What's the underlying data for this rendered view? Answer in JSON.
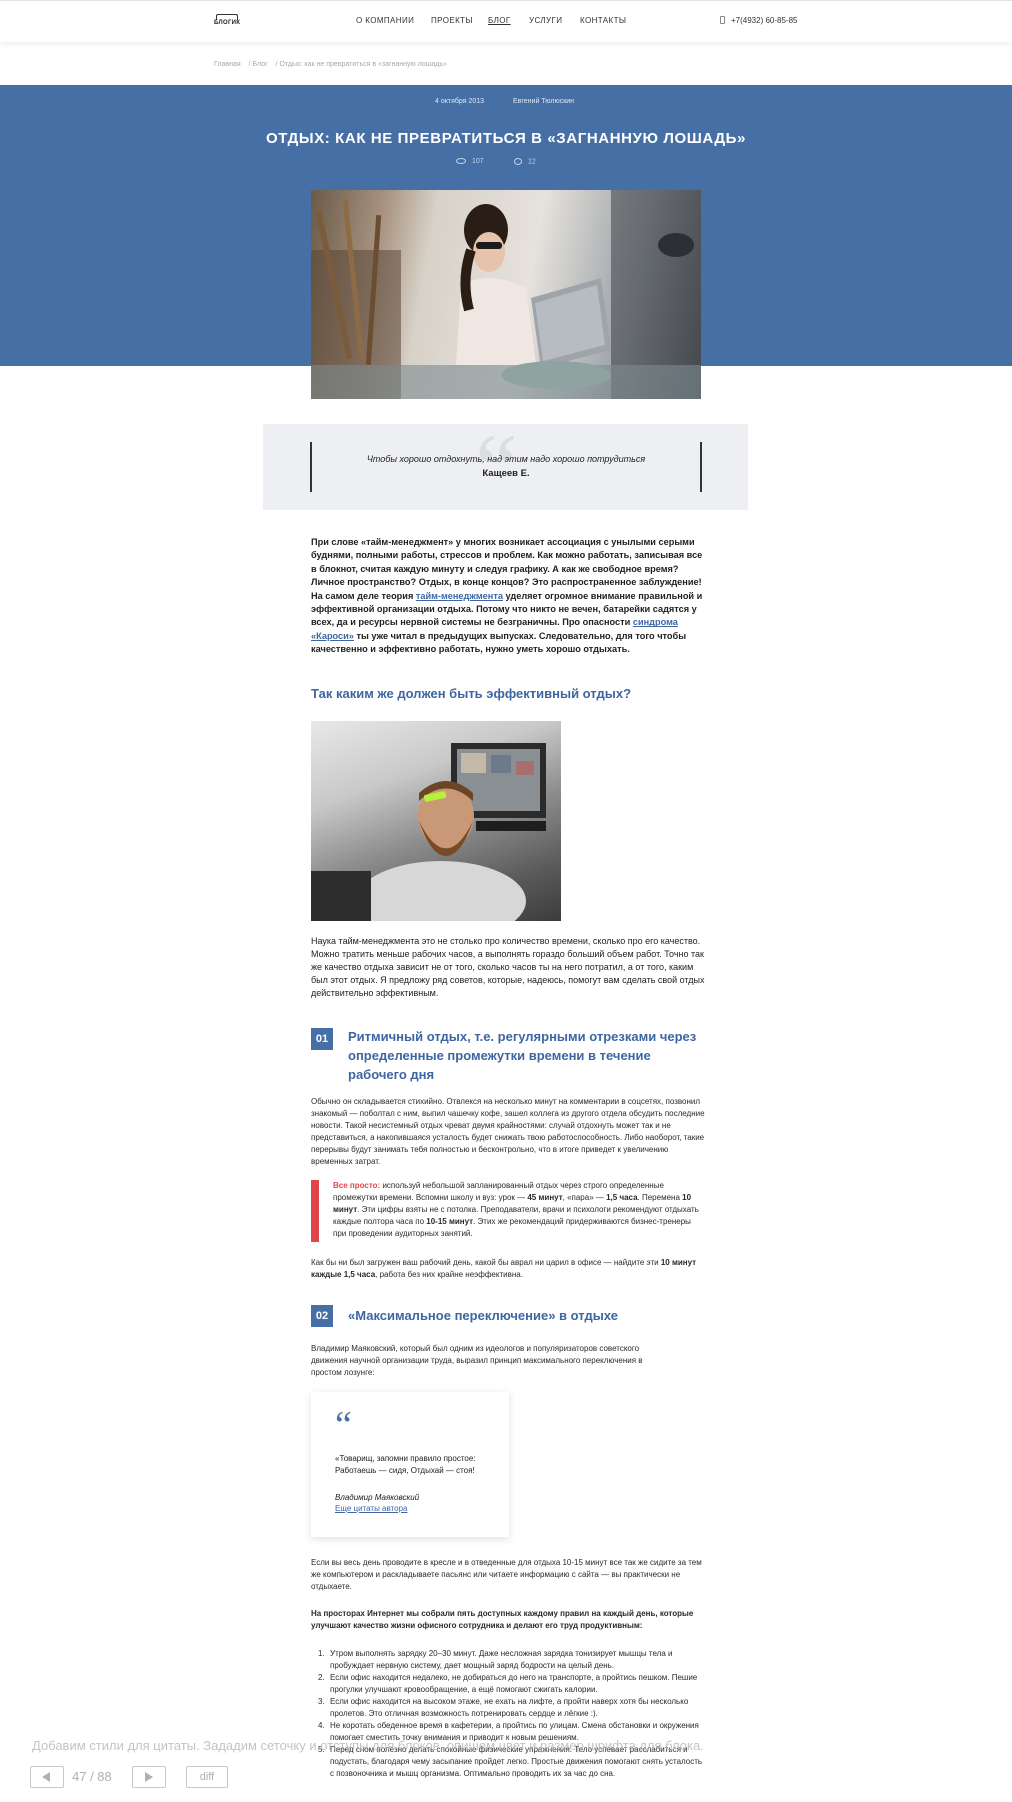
{
  "header": {
    "logo_text": "БЛОГИК",
    "nav": [
      "О КОМПАНИИ",
      "ПРОЕКТЫ",
      "БЛОГ",
      "УСЛУГИ",
      "КОНТАКТЫ"
    ],
    "phone": "+7(4932) 60-85-85"
  },
  "breadcrumb": [
    "Главная",
    "/ Блог",
    "/ Отдых: как не превратиться в «загнанную лошадь»"
  ],
  "article": {
    "date": "4 октября 2013",
    "author": "Евгений Тюлюскин",
    "title": "ОТДЫХ: КАК НЕ ПРЕВРАТИТЬСЯ В «ЗАГНАННУЮ ЛОШАДЬ»",
    "views": "107",
    "comments": "12"
  },
  "quote": {
    "text": "Чтобы хорошо отдохнуть, над этим надо хорошо потрудиться",
    "author": "Кащеев Е."
  },
  "intro": {
    "part1": "При слове «тайм-менеджмент» у многих возникает ассоциация с унылыми серыми буднями, полными работы, стрессов и проблем. Как можно работать, записывая все в блокнот, считая каждую минуту и следуя графику. А как же свободное время? Личное пространство? Отдых, в конце концов? Это распространенное заблуждение! На самом деле теория ",
    "link1": "тайм-менеджмента",
    "part2": " уделяет огромное внимание правильной и эффективной организации отдыха. Потому что никто не вечен, батарейки садятся у всех, да и ресурсы нервной системы не безграничны. Про опасности ",
    "link2": "синдрома «Кароси»",
    "part3": " ты уже читал в предыдущих выпусках. Следовательно, для того чтобы качественно и эффективно работать, нужно уметь хорошо отдыхать."
  },
  "section_heading": "Так каким же должен быть эффективный отдых?",
  "para2": "Наука тайм-менеджмента это не столько про количество времени, сколько про его качество. Можно тратить меньше рабочих часов, а выполнять гораздо больший объем работ. Точно так же качество отдыха зависит не от того, сколько часов ты на него потратил, а от того, каким был этот отдых. Я предложу ряд советов, которые, надеюсь, помогут вам сделать свой отдых действительно эффективным.",
  "step1": {
    "num": "01",
    "title": "Ритмичный отдых, т.е. регулярными отрезками через определенные промежутки времени в течение рабочего дня",
    "body": "Обычно он складывается стихийно. Отвлекся на несколько минут на комментарии в соцсетях, позвонил знакомый — поболтал с ним, выпил чашечку кофе, зашел коллега из другого отдела обсудить последние новости. Такой несистемный отдых чреват двумя крайностями: случай отдохнуть может так и не представиться, а накопившаяся усталость будет снижать твою работоспособность. Либо наоборот, такие перерывы будут занимать тебя полностью и бесконтрольно, что в итоге приведет к увеличению временных затрат.",
    "tip_label": "Все просто:",
    "tip_a": " используй небольшой запланированный отдых через строго определенные промежутки времени. Вспомни школу и вуз: урок — ",
    "tip_b": "45 минут",
    "tip_c": ", «пара» — ",
    "tip_d": "1,5 часа",
    "tip_e": ". Перемена ",
    "tip_f": "10 минут",
    "tip_g": ". Эти цифры взяты не с потолка. Преподаватели, врачи и психологи рекомендуют отдыхать каждые полтора часа по ",
    "tip_h": "10-15 минут",
    "tip_i": ". Этих же рекомендаций придерживаются бизнес-тренеры при проведении аудиторных занятий.",
    "after_a": "Как бы ни был загружен ваш рабочий день, какой бы аврал ни царил в офисе — найдите эти ",
    "after_b": "10 минут каждые 1,5 часа",
    "after_c": ", работа без них крайне неэффективна."
  },
  "step2": {
    "num": "02",
    "title": "«Максимальное переключение» в отдыхе",
    "body": "Владимир Маяковский, который был одним из идеологов и популяризаторов советского движения научной организации труда, выразил принцип максимального переключения в простом лозунге:",
    "card_quote": "«Товарищ, запомни правило простое: Работаешь — сидя, Отдыхай — стоя!",
    "card_author": "Владимир Маяковский",
    "card_link": "Еще цитаты автора",
    "para_a": "Если вы весь день проводите в кресле и в отведенные для отдыха 10-15 минут все так же сидите за тем же компьютером и раскладываете пасьянс или читаете информацию с сайта — вы практически не отдыхаете.",
    "para_b": "На просторах Интернет мы собрали пять доступных каждому правил на каждый день, которые улучшают качество жизни офисного сотрудника и делают его труд продуктивным:",
    "rules": [
      "Утром выполнять зарядку 20–30 минут. Даже несложная зарядка тонизирует мышцы тела и пробуждает нервную систему, дает мощный заряд бодрости на целый день.",
      "Если офис находится недалеко, не добираться до него на транспорте, а пройтись пешком. Пешие прогулки улучшают кровообращение, а ещё помогают сжигать калории.",
      "Если офис находится на высоком этаже, не ехать на лифте, а пройти наверх хотя бы несколько пролетов. Это отличная возможность потренировать сердце и лёгкие :).",
      "Не коротать обеденное время в кафетерии, а пройтись по улицам. Смена обстановки и окружения помогает сместить точку внимания и приводит к новым решениям.",
      "Перед сном полезно делать спокойные физические упражнения. Тело успевает расслабиться и подустать, благодаря чему засыпание пройдет легко. Простые движения помогают снять усталость с позвоночника и мышц организма. Оптимально проводить их за час до сна."
    ]
  },
  "overlay": {
    "hint": "Добавим стили для цитаты. Зададим сеточку и отступы для блоков, опишем цвет и размер шрифта для блока.",
    "counter": "47 / 88",
    "diff_label": "diff"
  }
}
